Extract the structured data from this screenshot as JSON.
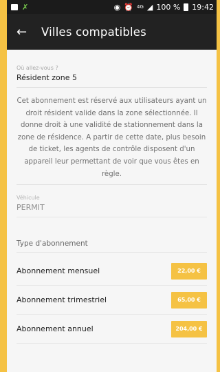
{
  "statusbar": {
    "network": "4G",
    "battery": "100 %",
    "time": "19:42"
  },
  "toolbar": {
    "title": "Villes compatibles"
  },
  "destination": {
    "label": "Où allez-vous ?",
    "value": "Résident zone 5"
  },
  "description": "Cet abonnement est réservé aux utilisateurs ayant un droit résident valide dans la zone sélectionnée. Il donne droit à une validité de stationnement dans la zone de résidence. A partir de cette date, plus besoin de ticket, les agents de contrôle disposent d'un appareil leur permettant de voir que vous êtes en règle.",
  "vehicle": {
    "label": "Véhicule",
    "value": "PERMIT"
  },
  "subscription": {
    "label": "Type d'abonnement",
    "items": [
      {
        "name": "Abonnement mensuel",
        "price": "22,00 €"
      },
      {
        "name": "Abonnement trimestriel",
        "price": "65,00 €"
      },
      {
        "name": "Abonnement annuel",
        "price": "204,00 €"
      }
    ]
  },
  "colors": {
    "accent": "#f5c244",
    "toolbar": "#222222",
    "statusbar": "#1b1b1b"
  }
}
